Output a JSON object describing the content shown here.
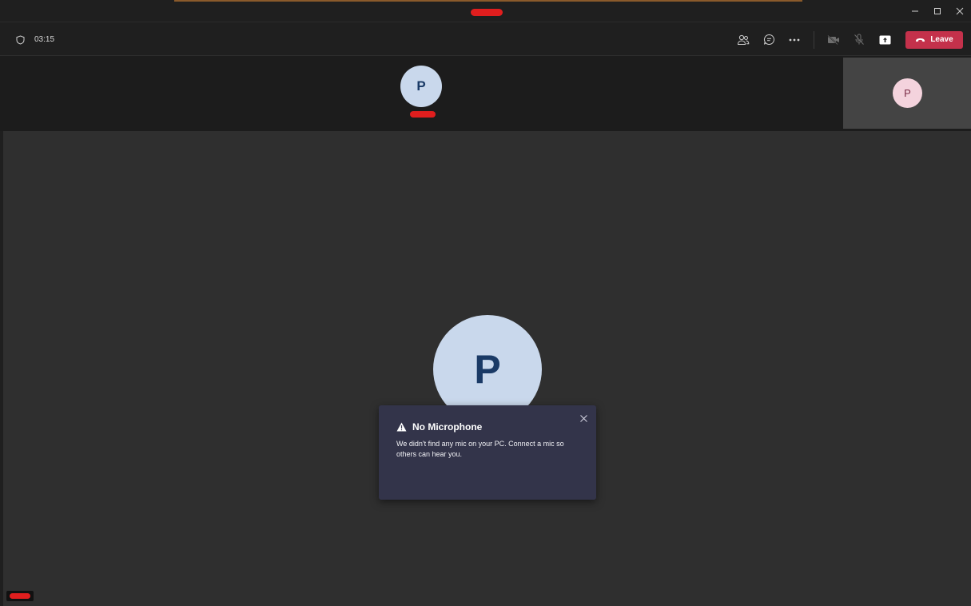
{
  "meeting": {
    "timer": "03:15",
    "leave_label": "Leave"
  },
  "participants": {
    "top_initial": "P",
    "self_initial": "P",
    "main_initial": "P"
  },
  "notification": {
    "title": "No Microphone",
    "message": "We didn't find any mic on your PC. Connect a mic so others can hear you."
  },
  "colors": {
    "leave": "#c4314b",
    "toast_bg": "#33344a",
    "avatar_bg": "#c9d8ec",
    "self_avatar_bg": "#f4d3dd"
  }
}
